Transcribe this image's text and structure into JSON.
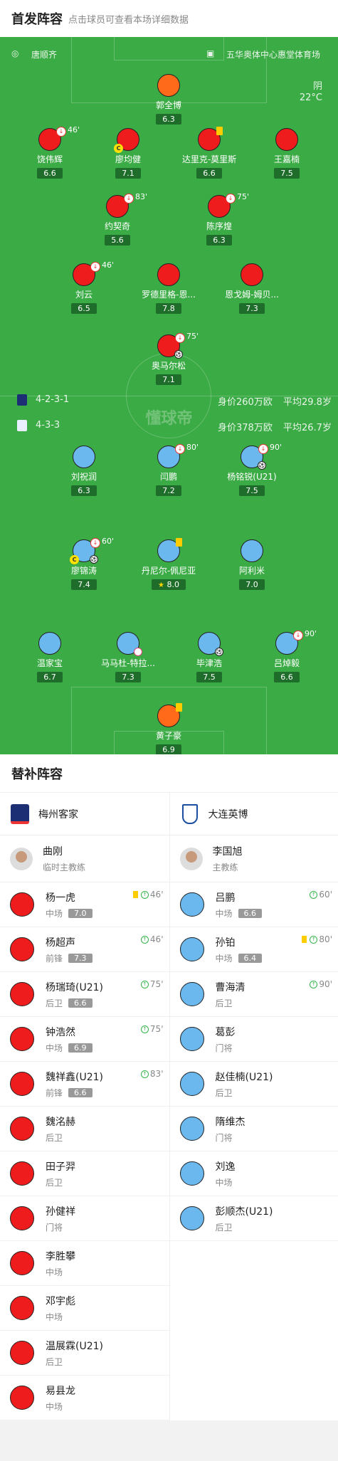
{
  "header": {
    "title": "首发阵容",
    "subtitle": "点击球员可查看本场详细数据"
  },
  "match": {
    "referee": "唐顺齐",
    "venue": "五华奥体中心惠堂体育场",
    "weather": "阴",
    "temp": "22°C",
    "watermark": "懂球帝"
  },
  "home_form": {
    "formation": "4-2-3-1",
    "value": "身价260万欧",
    "age": "平均29.8岁"
  },
  "away_form": {
    "formation": "4-3-3",
    "value": "身价378万欧",
    "age": "平均26.7岁"
  },
  "home_players": [
    {
      "name": "郭全博",
      "rating": "6.3"
    },
    {
      "name": "饶伟辉",
      "rating": "6.6",
      "sub": "46'"
    },
    {
      "name": "廖均健",
      "rating": "7.1"
    },
    {
      "name": "达里克-莫里斯",
      "rating": "6.6"
    },
    {
      "name": "王嘉楠",
      "rating": "7.5"
    },
    {
      "name": "约契奇",
      "rating": "5.6",
      "sub": "83'"
    },
    {
      "name": "陈序煌",
      "rating": "6.3",
      "sub": "75'"
    },
    {
      "name": "刘云",
      "rating": "6.5",
      "sub": "46'"
    },
    {
      "name": "罗德里格-恩...",
      "rating": "7.8"
    },
    {
      "name": "恩戈姆-姆贝...",
      "rating": "7.3"
    },
    {
      "name": "奥马尔松",
      "rating": "7.1",
      "sub": "75'"
    }
  ],
  "away_players": [
    {
      "name": "刘祝润",
      "rating": "6.3"
    },
    {
      "name": "闫鹏",
      "rating": "7.2",
      "sub": "80'"
    },
    {
      "name": "杨铭锐(U21)",
      "rating": "7.5",
      "sub": "90'"
    },
    {
      "name": "廖锦涛",
      "rating": "7.4",
      "sub": "60'"
    },
    {
      "name": "丹尼尔-佩尼亚",
      "rating": "8.0"
    },
    {
      "name": "阿利米",
      "rating": "7.0"
    },
    {
      "name": "温家宝",
      "rating": "6.7"
    },
    {
      "name": "马马杜-特拉...",
      "rating": "7.3"
    },
    {
      "name": "毕津浩",
      "rating": "7.5"
    },
    {
      "name": "吕焯毅",
      "rating": "6.6",
      "sub": "90'"
    },
    {
      "name": "黄子豪",
      "rating": "6.9"
    }
  ],
  "subs_title": "替补阵容",
  "home_team": {
    "name": "梅州客家",
    "coach": "曲刚",
    "coach_role": "临时主教练"
  },
  "away_team": {
    "name": "大连英博",
    "coach": "李国旭",
    "coach_role": "主教练"
  },
  "home_subs": [
    {
      "name": "杨一虎",
      "pos": "中场",
      "rating": "7.0",
      "time": "46'"
    },
    {
      "name": "杨超声",
      "pos": "前锋",
      "rating": "7.3",
      "time": "46'"
    },
    {
      "name": "杨瑞琦(U21)",
      "pos": "后卫",
      "rating": "6.6",
      "time": "75'"
    },
    {
      "name": "钟浩然",
      "pos": "中场",
      "rating": "6.9",
      "time": "75'"
    },
    {
      "name": "魏祥鑫(U21)",
      "pos": "前锋",
      "rating": "6.6",
      "time": "83'"
    },
    {
      "name": "魏洺赫",
      "pos": "后卫"
    },
    {
      "name": "田子羿",
      "pos": "后卫"
    },
    {
      "name": "孙健祥",
      "pos": "门将"
    },
    {
      "name": "李胜攀",
      "pos": "中场"
    },
    {
      "name": "邓宇彪",
      "pos": "中场"
    },
    {
      "name": "温展霖(U21)",
      "pos": "后卫"
    },
    {
      "name": "易县龙",
      "pos": "中场"
    }
  ],
  "away_subs": [
    {
      "name": "吕鹏",
      "pos": "中场",
      "rating": "6.6",
      "time": "60'"
    },
    {
      "name": "孙铂",
      "pos": "中场",
      "rating": "6.4",
      "time": "80'"
    },
    {
      "name": "曹海清",
      "pos": "后卫",
      "time": "90'"
    },
    {
      "name": "葛彭",
      "pos": "门将"
    },
    {
      "name": "赵佳楠(U21)",
      "pos": "后卫"
    },
    {
      "name": "隋维杰",
      "pos": "门将"
    },
    {
      "name": "刘逸",
      "pos": "中场"
    },
    {
      "name": "彭顺杰(U21)",
      "pos": "后卫"
    }
  ],
  "colors": {
    "pitch": "#3bab45",
    "home": "#ee1c1c",
    "away": "#6ab8ee",
    "keeper": "#ff6a1a"
  }
}
